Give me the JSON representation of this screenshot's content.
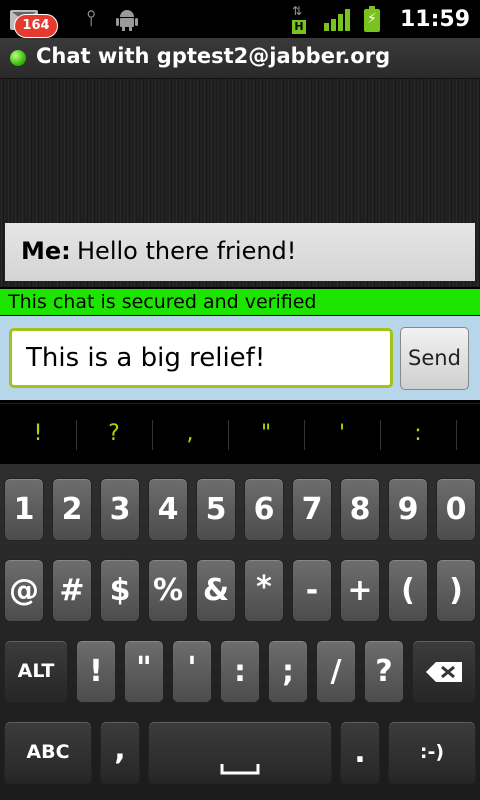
{
  "status_bar": {
    "notification_count": "164",
    "icons": [
      "gmail-icon",
      "usb-icon",
      "android-debug-icon",
      "hsdpa-icon",
      "signal-icon",
      "battery-charging-icon"
    ],
    "time": "11:59",
    "accent_color": "#7ac21d"
  },
  "header": {
    "title": "Chat with gptest2@jabber.org",
    "presence_color": "#3dbb12"
  },
  "messages": [
    {
      "sender": "Me:",
      "text": "Hello there friend!"
    }
  ],
  "security_banner": {
    "text": "This chat is secured and verified",
    "color": "#1ce600"
  },
  "compose": {
    "value": "This is a big relief!",
    "send_label": "Send"
  },
  "suggestions": [
    "!",
    "?",
    ",",
    "\"",
    "'",
    ":"
  ],
  "keyboard": {
    "row1": [
      "1",
      "2",
      "3",
      "4",
      "5",
      "6",
      "7",
      "8",
      "9",
      "0"
    ],
    "row2": [
      "@",
      "#",
      "$",
      "%",
      "&",
      "*",
      "-",
      "+",
      "(",
      ")"
    ],
    "row3": {
      "alt": "ALT",
      "keys": [
        "!",
        "\"",
        "'",
        ":",
        ";",
        "/",
        "?"
      ],
      "delete_icon": "backspace-icon"
    },
    "row4": {
      "mode": "ABC",
      "comma": ",",
      "period": ".",
      "smiley": ":-)",
      "space_icon": "space-icon"
    }
  }
}
